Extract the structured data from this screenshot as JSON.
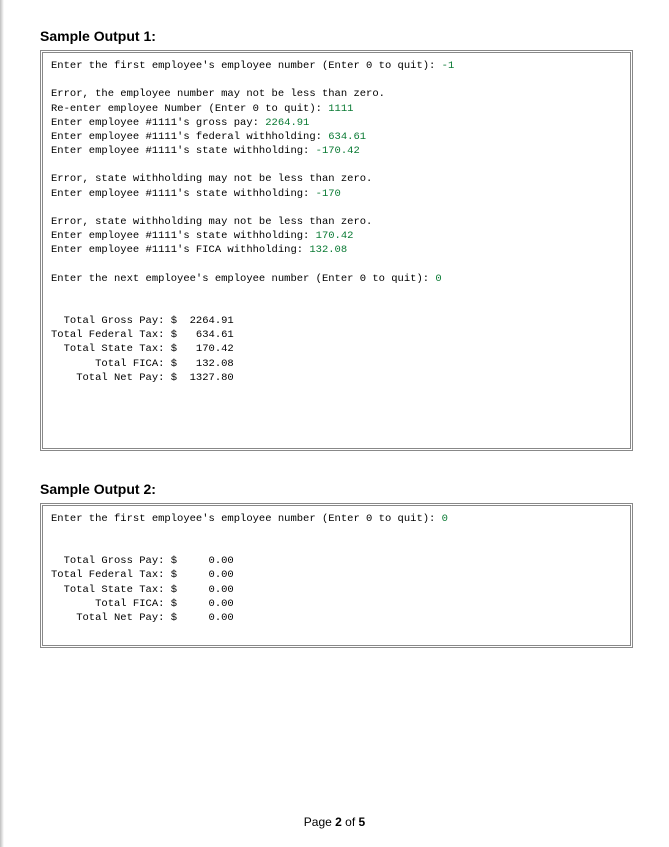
{
  "sample1": {
    "title": "Sample Output 1:",
    "lines": [
      {
        "t": "Enter the first employee's employee number (Enter 0 to quit): ",
        "i": "-1"
      },
      {
        "blank": true
      },
      {
        "t": "Error, the employee number may not be less than zero."
      },
      {
        "t": "Re-enter employee Number (Enter 0 to quit): ",
        "i": "1111"
      },
      {
        "t": "Enter employee #1111's gross pay: ",
        "i": "2264.91"
      },
      {
        "t": "Enter employee #1111's federal withholding: ",
        "i": "634.61"
      },
      {
        "t": "Enter employee #1111's state withholding: ",
        "i": "-170.42"
      },
      {
        "blank": true
      },
      {
        "t": "Error, state withholding may not be less than zero."
      },
      {
        "t": "Enter employee #1111's state withholding: ",
        "i": "-170"
      },
      {
        "blank": true
      },
      {
        "t": "Error, state withholding may not be less than zero."
      },
      {
        "t": "Enter employee #1111's state withholding: ",
        "i": "170.42"
      },
      {
        "t": "Enter employee #1111's FICA withholding: ",
        "i": "132.08"
      },
      {
        "blank": true
      },
      {
        "t": "Enter the next employee's employee number (Enter 0 to quit): ",
        "i": "0"
      },
      {
        "blank": true
      },
      {
        "blank": true
      },
      {
        "t": "  Total Gross Pay: $  2264.91"
      },
      {
        "t": "Total Federal Tax: $   634.61"
      },
      {
        "t": "  Total State Tax: $   170.42"
      },
      {
        "t": "       Total FICA: $   132.08"
      },
      {
        "t": "    Total Net Pay: $  1327.80"
      },
      {
        "blank": true
      },
      {
        "blank": true
      },
      {
        "blank": true
      },
      {
        "blank": true
      }
    ]
  },
  "sample2": {
    "title": "Sample Output 2:",
    "lines": [
      {
        "t": "Enter the first employee's employee number (Enter 0 to quit): ",
        "i": "0"
      },
      {
        "blank": true
      },
      {
        "blank": true
      },
      {
        "t": "  Total Gross Pay: $     0.00"
      },
      {
        "t": "Total Federal Tax: $     0.00"
      },
      {
        "t": "  Total State Tax: $     0.00"
      },
      {
        "t": "       Total FICA: $     0.00"
      },
      {
        "t": "    Total Net Pay: $     0.00"
      },
      {
        "blank": true
      }
    ]
  },
  "footer": {
    "prefix": "Page ",
    "current": "2",
    "of": " of ",
    "total": "5"
  }
}
